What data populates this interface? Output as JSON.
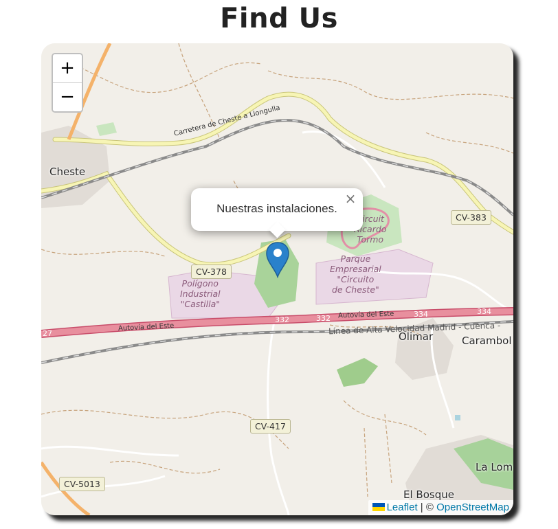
{
  "page": {
    "title": "Find Us"
  },
  "map": {
    "zoom_in_label": "+",
    "zoom_out_label": "−",
    "popup": {
      "text": "Nuestras instalaciones.",
      "close_label": "×"
    },
    "marker_color": "#2a81cb",
    "places": {
      "cheste": "Cheste",
      "olimar": "Olimar",
      "carambolas": "Carambol",
      "la_loma": "La Lom",
      "el_bosque": "El Bosque"
    },
    "areas": {
      "poligono": [
        "Polígono",
        "Industrial",
        "\"Castilla\""
      ],
      "circuit": [
        "Circuit",
        "Ricardo",
        "Tormo"
      ],
      "parque": [
        "Parque",
        "Empresarial",
        "\"Circuito",
        "de Cheste\""
      ]
    },
    "road_labels": {
      "carretera": "Carretera de Cheste a Llongulla",
      "autovia_left": "Autovía del Este",
      "autovia_right": "Autovía del Este",
      "rail": "Línea de Alta Velocidad Madrid - Cuenca -"
    },
    "shields": {
      "cv378": "CV-378",
      "cv383": "CV-383",
      "cv417": "CV-417",
      "cv5013": "CV-5013",
      "a332a": "332",
      "a332b": "332",
      "a334a": "334",
      "a334b": "334",
      "a27": "27"
    },
    "attribution": {
      "leaflet": "Leaflet",
      "separator": "| ©",
      "osm": "OpenStreetMap"
    },
    "colors": {
      "land": "#f2efe9",
      "motorway": "#e5808d",
      "primary_road": "#f0eca0",
      "industrial": "#e8d7e4",
      "park": "#acd29f",
      "rail": "#777777"
    }
  }
}
